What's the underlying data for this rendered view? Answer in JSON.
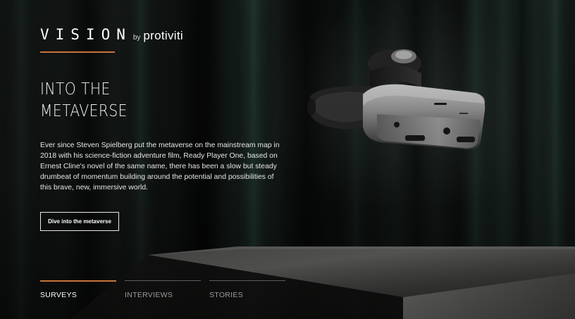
{
  "brand": {
    "vision": "VISION",
    "by": "by",
    "company": "protiviti"
  },
  "hero": {
    "title_line1": "INTO THE",
    "title_line2": "METAVERSE",
    "body": "Ever since Steven Spielberg put the metaverse on the mainstream map in 2018 with his science-fiction adventure film, Ready Player One, based on Ernest Cline's novel of the same name, there has been a slow but steady drumbeat of momentum building around the potential and possibilities of this brave, new, immersive world.",
    "cta_label": "Dive into the metaverse"
  },
  "tabs": [
    {
      "label": "SURVEYS",
      "active": true
    },
    {
      "label": "INTERVIEWS",
      "active": false
    },
    {
      "label": "STORIES",
      "active": false
    }
  ],
  "colors": {
    "accent": "#c8733a",
    "background": "#0b0d0c",
    "text": "#ffffff",
    "tab_inactive": "#9a9c9b"
  },
  "images": {
    "headset": "vr-headset-image",
    "pedestal": "display-pedestal-image"
  }
}
